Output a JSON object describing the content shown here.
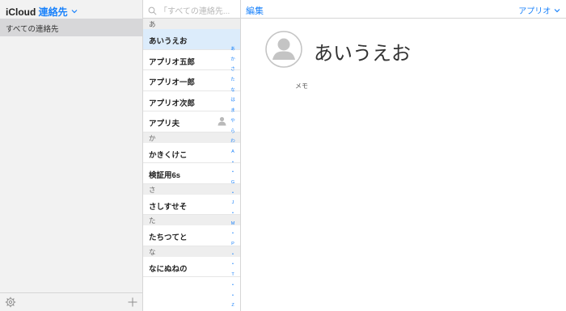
{
  "sidebar": {
    "app_name": "iCloud",
    "section_name": "連絡先",
    "groups": [
      {
        "label": "すべての連絡先"
      }
    ]
  },
  "list": {
    "search_placeholder": "「すべての連絡先...",
    "sections": [
      {
        "header": "あ",
        "rows": [
          "あいうえお",
          "アプリオ五郎",
          "アプリオ一郎",
          "アプリオ次郎",
          "アプリ夫"
        ]
      },
      {
        "header": "か",
        "rows": [
          "かきくけこ",
          "検証用6s"
        ]
      },
      {
        "header": "さ",
        "rows": [
          "さしすせそ"
        ]
      },
      {
        "header": "た",
        "rows": [
          "たちつてと"
        ]
      },
      {
        "header": "な",
        "rows": [
          "なにぬねの"
        ]
      }
    ],
    "index": [
      "あ",
      "か",
      "さ",
      "た",
      "な",
      "は",
      "ま",
      "や",
      "ら",
      "わ",
      "A",
      "•",
      "•",
      "G",
      "•",
      "J",
      "•",
      "M",
      "•",
      "P",
      "•",
      "•",
      "T",
      "•",
      "•",
      "Z",
      "#"
    ]
  },
  "detail": {
    "edit_label": "編集",
    "user_label": "アプリオ",
    "contact_name": "あいうえお",
    "memo_label": "メモ"
  },
  "colors": {
    "accent": "#1a82fb",
    "selected_row": "#dcecfb",
    "group_selected": "#d7d7d9"
  }
}
